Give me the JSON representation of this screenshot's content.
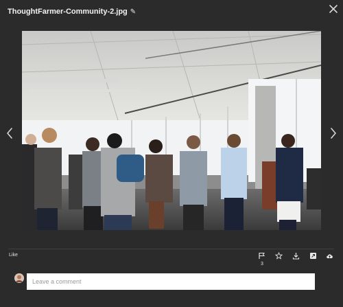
{
  "header": {
    "title": "ThoughtFarmer-Community-2.jpg",
    "edit_icon": "pencil-icon",
    "close_icon": "close-icon"
  },
  "navigation": {
    "prev_icon": "chevron-left-icon",
    "next_icon": "chevron-right-icon"
  },
  "image": {
    "subject": "photo"
  },
  "footer": {
    "like_label": "Like",
    "flag_count": "3",
    "icons": [
      "flag-icon",
      "star-icon",
      "download-icon",
      "open-external-icon",
      "cloud-upload-icon"
    ]
  },
  "comment": {
    "placeholder": "Leave a comment"
  }
}
